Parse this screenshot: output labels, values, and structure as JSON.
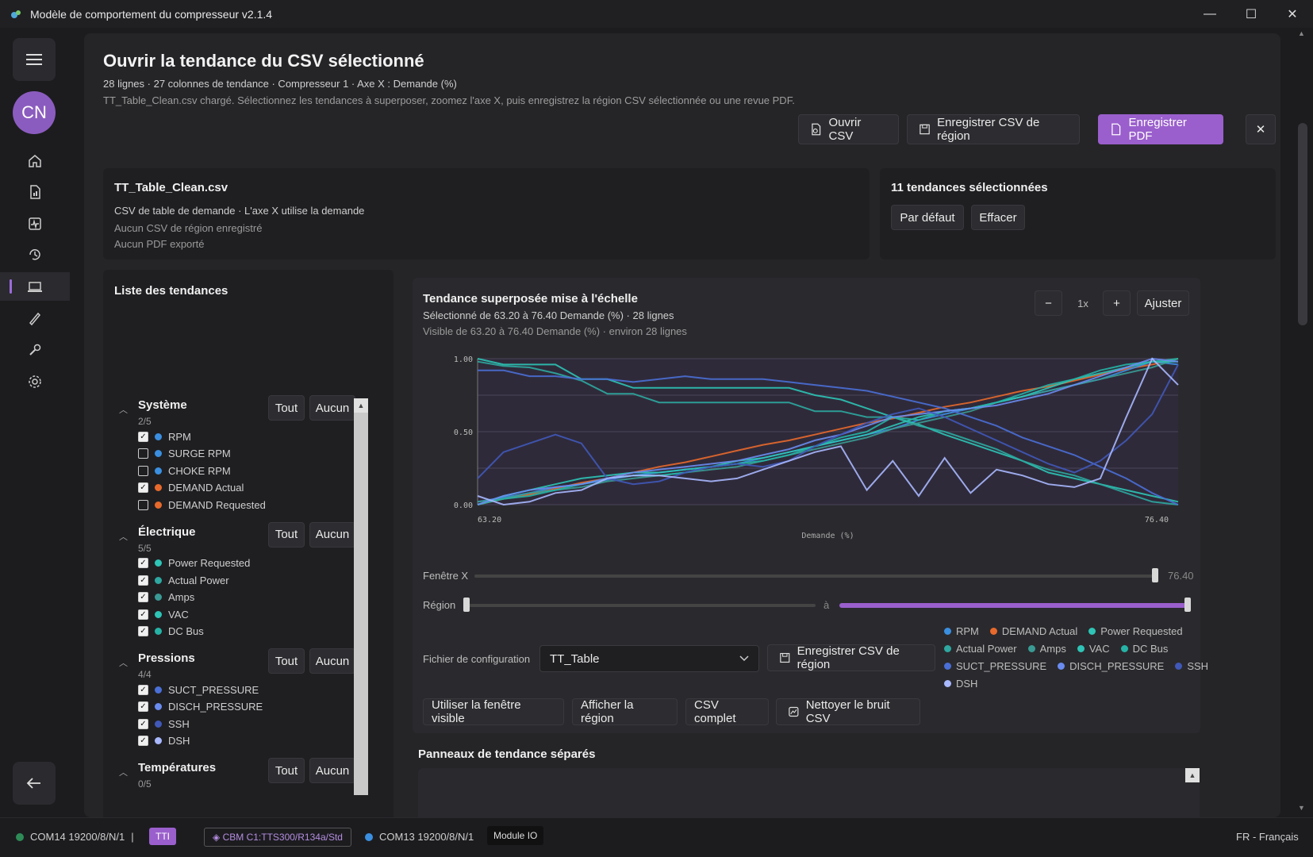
{
  "window": {
    "title": "Modèle de comportement du compresseur v2.1.4"
  },
  "rail": {
    "avatar": "CN"
  },
  "header": {
    "title": "Ouvrir la tendance du CSV sélectionné",
    "meta": "28 lignes · 27 colonnes de tendance · Compresseur 1 · Axe X : Demande (%)",
    "info": "TT_Table_Clean.csv chargé. Sélectionnez les tendances à superposer, zoomez l'axe X, puis enregistrez la région CSV sélectionnée ou une revue PDF.",
    "btn_open": "Ouvrir CSV",
    "btn_save_region": "Enregistrer CSV de région",
    "btn_save_pdf": "Enregistrer PDF",
    "btn_close": "✕"
  },
  "file_card": {
    "name": "TT_Table_Clean.csv",
    "desc": "CSV de table de demande · L'axe X utilise la demande",
    "region_status": "Aucun CSV de région enregistré",
    "pdf_status": "Aucun PDF exporté"
  },
  "selection_card": {
    "title": "11 tendances sélectionnées",
    "btn_default": "Par défaut",
    "btn_clear": "Effacer"
  },
  "trend_list": {
    "title": "Liste des tendances",
    "all_label": "Tout",
    "none_label": "Aucun",
    "groups": [
      {
        "name": "Système",
        "count": "2/5",
        "items": [
          {
            "label": "RPM",
            "checked": true,
            "color": "#3b8fe0"
          },
          {
            "label": "SURGE RPM",
            "checked": false,
            "color": "#3b8fe0"
          },
          {
            "label": "CHOKE RPM",
            "checked": false,
            "color": "#3b8fe0"
          },
          {
            "label": "DEMAND Actual",
            "checked": true,
            "color": "#e8692c"
          },
          {
            "label": "DEMAND Requested",
            "checked": false,
            "color": "#e8692c"
          }
        ]
      },
      {
        "name": "Électrique",
        "count": "5/5",
        "items": [
          {
            "label": "Power Requested",
            "checked": true,
            "color": "#2ec4b6"
          },
          {
            "label": "Actual Power",
            "checked": true,
            "color": "#2ea8a0"
          },
          {
            "label": "Amps",
            "checked": true,
            "color": "#3a9a94"
          },
          {
            "label": "VAC",
            "checked": true,
            "color": "#2ec4b6"
          },
          {
            "label": "DC Bus",
            "checked": true,
            "color": "#26b3a6"
          }
        ]
      },
      {
        "name": "Pressions",
        "count": "4/4",
        "items": [
          {
            "label": "SUCT_PRESSURE",
            "checked": true,
            "color": "#4a6fd6"
          },
          {
            "label": "DISCH_PRESSURE",
            "checked": true,
            "color": "#6a8cf0"
          },
          {
            "label": "SSH",
            "checked": true,
            "color": "#4058b8"
          },
          {
            "label": "DSH",
            "checked": true,
            "color": "#a9b8ff"
          }
        ]
      },
      {
        "name": "Températures",
        "count": "0/5",
        "items": []
      }
    ]
  },
  "chart_panel": {
    "title": "Tendance superposée mise à l'échelle",
    "selected": "Sélectionné de 63.20 à 76.40 Demande (%) · 28 lignes",
    "visible": "Visible de 63.20 à 76.40 Demande (%) · environ 28 lignes",
    "zoom_minus": "−",
    "zoom_level": "1x",
    "zoom_plus": "+",
    "fit": "Ajuster",
    "window_label": "Fenêtre X",
    "window_value": "76.40",
    "region_label": "Région",
    "region_to": "à",
    "config_label": "Fichier de configuration",
    "config_value": "TT_Table",
    "btn_save_region": "Enregistrer CSV de région",
    "btn_use_visible": "Utiliser la fenêtre visible",
    "btn_show_region": "Afficher la région",
    "btn_full_csv": "CSV complet",
    "btn_clean": "Nettoyer le bruit CSV",
    "legend": [
      {
        "name": "RPM",
        "color": "#3b8fe0"
      },
      {
        "name": "DEMAND Actual",
        "color": "#e8692c"
      },
      {
        "name": "Power Requested",
        "color": "#2ec4b6"
      },
      {
        "name": "Actual Power",
        "color": "#2ea8a0"
      },
      {
        "name": "Amps",
        "color": "#3a9a94"
      },
      {
        "name": "VAC",
        "color": "#2ec4b6"
      },
      {
        "name": "DC Bus",
        "color": "#26b3a6"
      },
      {
        "name": "SUCT_PRESSURE",
        "color": "#4a6fd6"
      },
      {
        "name": "DISCH_PRESSURE",
        "color": "#6a8cf0"
      },
      {
        "name": "SSH",
        "color": "#4058b8"
      },
      {
        "name": "DSH",
        "color": "#a9b8ff"
      }
    ]
  },
  "separate_panels": {
    "title": "Panneaux de tendance séparés"
  },
  "statusbar": {
    "port1": "COM14 19200/8/N/1",
    "sep": "|",
    "tag1": "TTI",
    "cbm": "◈ CBM C1:TTS300/R134a/Std",
    "port2": "COM13 19200/8/N/1",
    "module": "Module IO",
    "lang": "FR - Français"
  },
  "chart_data": {
    "type": "line",
    "title": "",
    "xlabel": "Demande (%)",
    "ylabel": "",
    "xlim": [
      63.2,
      76.4
    ],
    "ylim": [
      0,
      1
    ],
    "yticks": [
      "1.00",
      "0.50",
      "0.00"
    ],
    "xticks": [
      "63.20",
      "76.40"
    ],
    "grid": true,
    "series": [
      {
        "name": "DEMAND Actual",
        "color": "#e8692c",
        "values": [
          0.0,
          0.04,
          0.07,
          0.11,
          0.15,
          0.18,
          0.22,
          0.26,
          0.29,
          0.33,
          0.37,
          0.41,
          0.44,
          0.48,
          0.52,
          0.56,
          0.59,
          0.63,
          0.67,
          0.7,
          0.74,
          0.78,
          0.81,
          0.85,
          0.89,
          0.93,
          0.96,
          1.0
        ]
      },
      {
        "name": "RPM",
        "color": "#3b8fe0",
        "values": [
          0.02,
          0.05,
          0.08,
          0.12,
          0.14,
          0.17,
          0.2,
          0.22,
          0.24,
          0.26,
          0.28,
          0.32,
          0.36,
          0.4,
          0.44,
          0.48,
          0.52,
          0.58,
          0.62,
          0.66,
          0.7,
          0.74,
          0.78,
          0.82,
          0.86,
          0.92,
          0.98,
          0.96
        ]
      },
      {
        "name": "Power Requested",
        "color": "#2ec4b6",
        "values": [
          1.0,
          0.96,
          0.96,
          0.96,
          0.86,
          0.86,
          0.8,
          0.8,
          0.8,
          0.8,
          0.8,
          0.8,
          0.8,
          0.75,
          0.72,
          0.66,
          0.6,
          0.55,
          0.48,
          0.42,
          0.36,
          0.3,
          0.22,
          0.18,
          0.14,
          0.1,
          0.06,
          0.02
        ]
      },
      {
        "name": "Actual Power",
        "color": "#2ea8a0",
        "values": [
          0.98,
          0.95,
          0.94,
          0.9,
          0.85,
          0.76,
          0.76,
          0.7,
          0.7,
          0.7,
          0.7,
          0.7,
          0.7,
          0.64,
          0.64,
          0.6,
          0.6,
          0.54,
          0.5,
          0.44,
          0.38,
          0.3,
          0.24,
          0.2,
          0.14,
          0.08,
          0.02,
          0.0
        ]
      },
      {
        "name": "Amps",
        "color": "#3a9a94",
        "values": [
          0.02,
          0.04,
          0.08,
          0.1,
          0.12,
          0.16,
          0.18,
          0.2,
          0.22,
          0.24,
          0.26,
          0.3,
          0.34,
          0.38,
          0.42,
          0.46,
          0.52,
          0.56,
          0.6,
          0.64,
          0.7,
          0.74,
          0.78,
          0.82,
          0.86,
          0.9,
          0.94,
          1.0
        ]
      },
      {
        "name": "VAC",
        "color": "#2ec4b6",
        "values": [
          0.0,
          0.06,
          0.1,
          0.14,
          0.18,
          0.2,
          0.22,
          0.22,
          0.24,
          0.26,
          0.3,
          0.32,
          0.36,
          0.4,
          0.44,
          0.48,
          0.54,
          0.6,
          0.64,
          0.66,
          0.7,
          0.74,
          0.8,
          0.86,
          0.9,
          0.94,
          0.98,
          0.98
        ]
      },
      {
        "name": "DC Bus",
        "color": "#26b3a6",
        "values": [
          0.0,
          0.04,
          0.06,
          0.1,
          0.14,
          0.18,
          0.2,
          0.2,
          0.22,
          0.26,
          0.28,
          0.3,
          0.34,
          0.4,
          0.46,
          0.5,
          0.6,
          0.58,
          0.64,
          0.66,
          0.7,
          0.76,
          0.82,
          0.86,
          0.92,
          0.96,
          0.98,
          1.0
        ]
      },
      {
        "name": "SUCT_PRESSURE",
        "color": "#4a6fd6",
        "values": [
          0.92,
          0.92,
          0.88,
          0.88,
          0.86,
          0.86,
          0.84,
          0.86,
          0.88,
          0.86,
          0.86,
          0.86,
          0.84,
          0.82,
          0.8,
          0.78,
          0.74,
          0.7,
          0.66,
          0.6,
          0.54,
          0.46,
          0.4,
          0.34,
          0.26,
          0.18,
          0.08,
          0.0
        ]
      },
      {
        "name": "DISCH_PRESSURE",
        "color": "#6a8cf0",
        "values": [
          0.0,
          0.06,
          0.1,
          0.12,
          0.14,
          0.18,
          0.22,
          0.24,
          0.26,
          0.28,
          0.3,
          0.34,
          0.38,
          0.44,
          0.48,
          0.54,
          0.6,
          0.62,
          0.64,
          0.66,
          0.68,
          0.72,
          0.76,
          0.82,
          0.88,
          0.94,
          1.0,
          0.98
        ]
      },
      {
        "name": "SSH",
        "color": "#4058b8",
        "values": [
          0.18,
          0.36,
          0.42,
          0.48,
          0.42,
          0.18,
          0.14,
          0.16,
          0.22,
          0.26,
          0.28,
          0.26,
          0.3,
          0.4,
          0.48,
          0.56,
          0.62,
          0.66,
          0.6,
          0.52,
          0.44,
          0.36,
          0.28,
          0.22,
          0.3,
          0.44,
          0.62,
          0.96
        ]
      },
      {
        "name": "DSH",
        "color": "#a9b8ff",
        "values": [
          0.06,
          0.0,
          0.02,
          0.08,
          0.1,
          0.18,
          0.2,
          0.2,
          0.18,
          0.16,
          0.18,
          0.24,
          0.3,
          0.36,
          0.4,
          0.1,
          0.3,
          0.06,
          0.32,
          0.08,
          0.24,
          0.2,
          0.14,
          0.12,
          0.18,
          0.6,
          1.0,
          0.82
        ]
      }
    ]
  }
}
